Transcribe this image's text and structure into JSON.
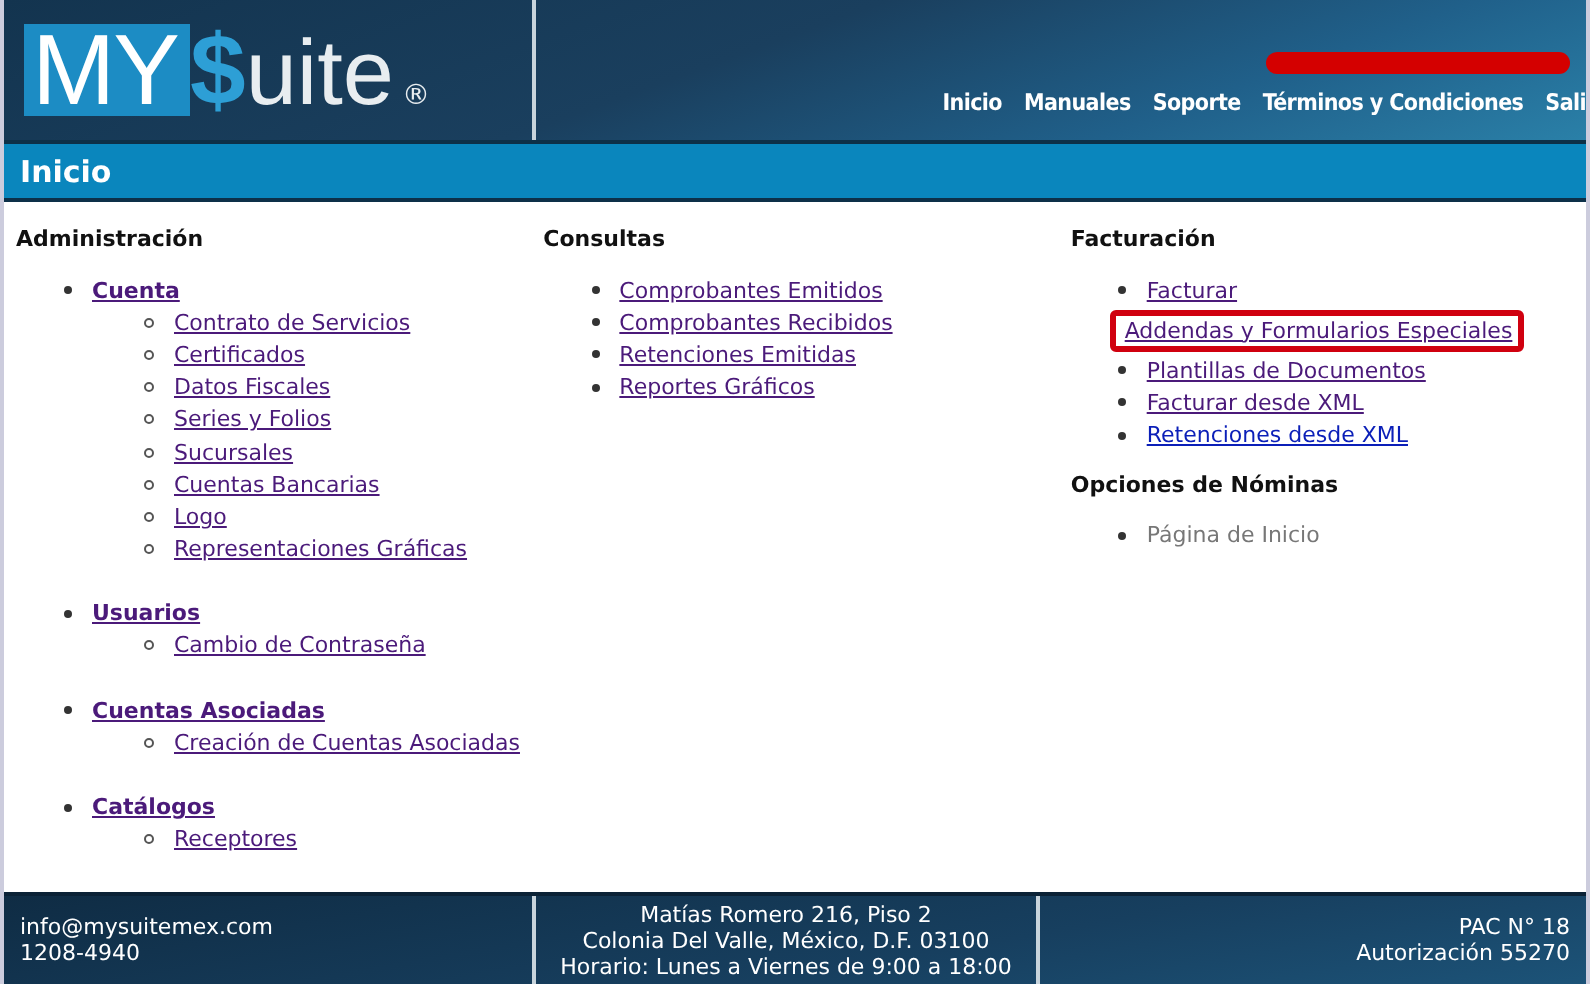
{
  "header": {
    "logo": {
      "brand_box": "MY",
      "dollar": "$",
      "rest": "uite",
      "mark": "®"
    },
    "nav": [
      {
        "label": "Inicio"
      },
      {
        "label": "Manuales"
      },
      {
        "label": "Soporte"
      },
      {
        "label": "Términos y Condiciones"
      },
      {
        "label": "Sali"
      }
    ]
  },
  "page_title": "Inicio",
  "columns": [
    {
      "sections": [
        {
          "title": "Administración",
          "items": [
            {
              "label": "Cuenta",
              "kind": "group",
              "visited": true,
              "children": [
                {
                  "label": "Contrato de Servicios",
                  "visited": true
                },
                {
                  "label": "Certificados",
                  "visited": true
                },
                {
                  "label": "Datos Fiscales",
                  "visited": true
                },
                {
                  "label": "Series y Folios",
                  "visited": true
                },
                {
                  "label": "Sucursales",
                  "visited": true
                },
                {
                  "label": "Cuentas Bancarias",
                  "visited": true
                },
                {
                  "label": "Logo",
                  "visited": true
                },
                {
                  "label": "Representaciones Gráficas",
                  "visited": true
                }
              ]
            },
            {
              "label": "Usuarios",
              "kind": "group",
              "visited": true,
              "children": [
                {
                  "label": "Cambio de Contraseña",
                  "visited": true
                }
              ]
            },
            {
              "label": "Cuentas Asociadas",
              "kind": "group",
              "visited": true,
              "children": [
                {
                  "label": "Creación de Cuentas Asociadas",
                  "visited": true
                }
              ]
            },
            {
              "label": "Catálogos",
              "kind": "group",
              "visited": true,
              "children": [
                {
                  "label": "Receptores",
                  "visited": true
                }
              ]
            }
          ]
        }
      ]
    },
    {
      "sections": [
        {
          "title": "Consultas",
          "items": [
            {
              "label": "Comprobantes Emitidos",
              "kind": "link",
              "visited": true
            },
            {
              "label": "Comprobantes Recibidos",
              "kind": "link",
              "visited": true
            },
            {
              "label": "Retenciones Emitidas",
              "kind": "link",
              "visited": true
            },
            {
              "label": "Reportes Gráficos",
              "kind": "link",
              "visited": true
            }
          ]
        }
      ]
    },
    {
      "sections": [
        {
          "title": "Facturación",
          "items": [
            {
              "label": "Facturar",
              "kind": "link",
              "visited": true
            },
            {
              "label": "Addendas y Formularios Especiales",
              "kind": "link",
              "visited": true,
              "highlighted": true
            },
            {
              "label": "Plantillas de Documentos",
              "kind": "link",
              "visited": true
            },
            {
              "label": "Facturar desde XML",
              "kind": "link",
              "visited": true
            },
            {
              "label": "Retenciones desde XML",
              "kind": "link",
              "visited": false
            }
          ]
        },
        {
          "title": "Opciones de Nóminas",
          "items": [
            {
              "label": "Página de Inicio",
              "kind": "text"
            }
          ]
        }
      ]
    }
  ],
  "footer": {
    "contact": [
      "info@mysuitemex.com",
      "1208-4940"
    ],
    "address": [
      "Matías Romero 216, Piso 2",
      "Colonia Del Valle, México, D.F. 03100",
      "Horario: Lunes a Viernes de 9:00 a 18:00"
    ],
    "legal": [
      "PAC N° 18",
      "Autorización 55270"
    ]
  }
}
